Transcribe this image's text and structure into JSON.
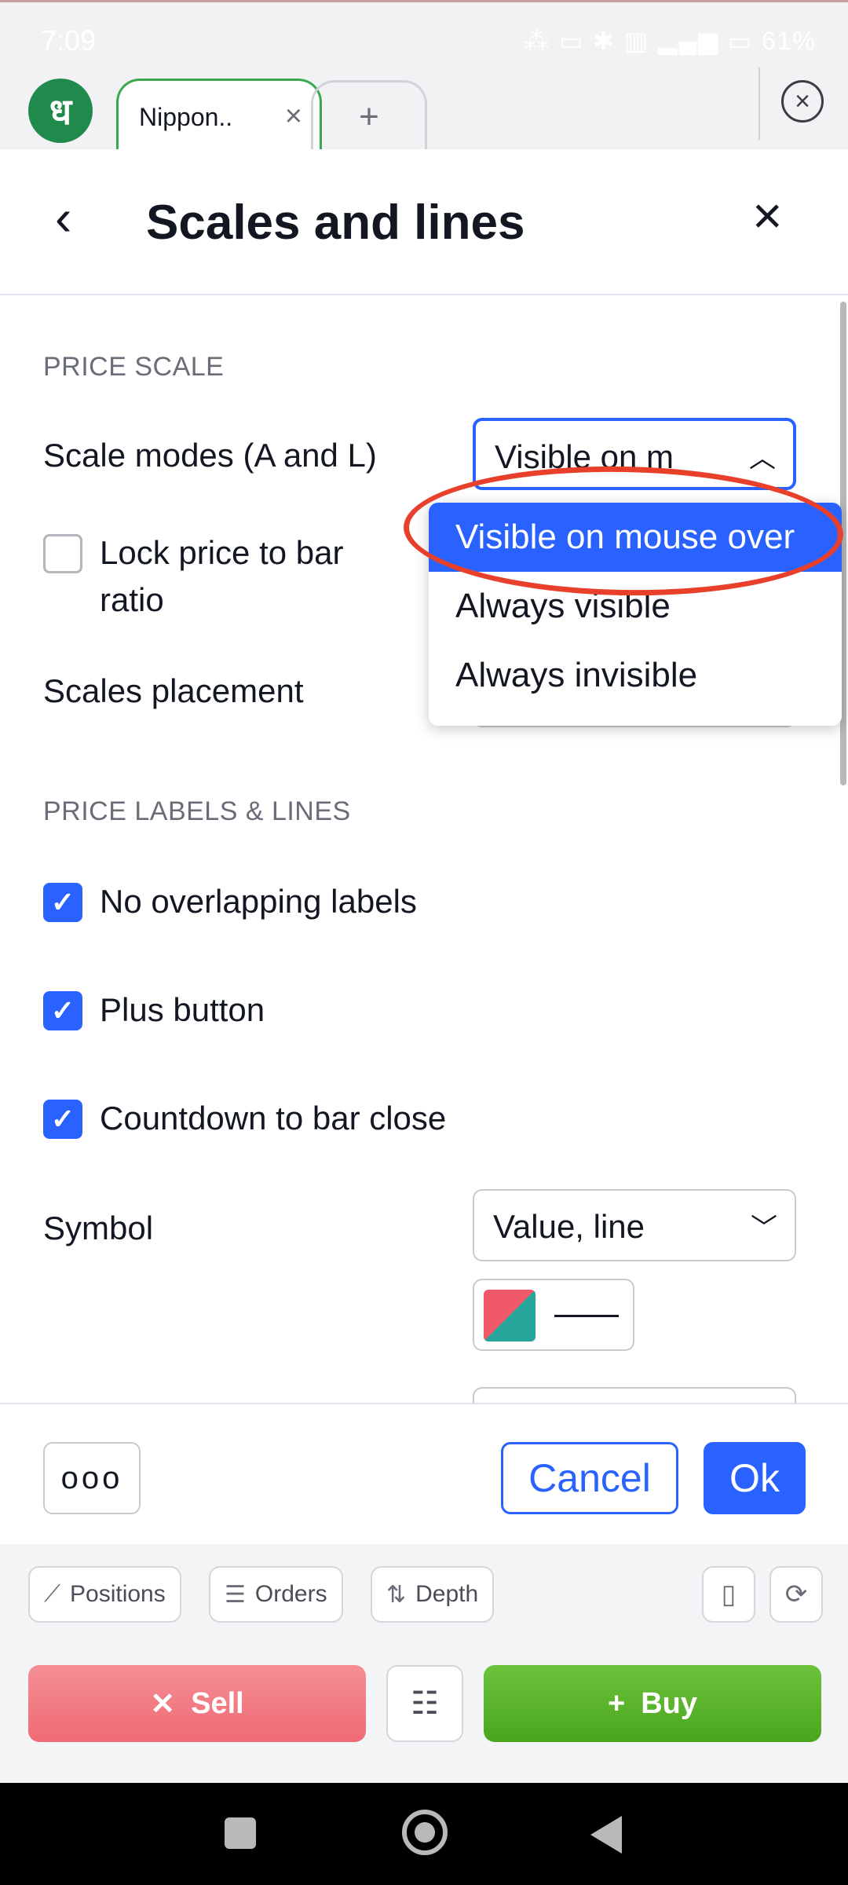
{
  "status_bar": {
    "time": "7:09",
    "icons_text": "⁂ ▭ ✱ ▥ ▂▄▆ ▭ 61%"
  },
  "tabs": {
    "logo_text": "ध",
    "active_label": "Nippon..",
    "close_glyph": "×",
    "new_tab_glyph": "+",
    "bar_close_glyph": "×"
  },
  "header": {
    "back_glyph": "‹",
    "title": "Scales and lines",
    "close_glyph": "×"
  },
  "price_scale": {
    "section_title": "PRICE SCALE",
    "scale_modes_label": "Scale modes (A and L)",
    "scale_modes_value": "Visible on m",
    "lock_price_label_1": "Lock price to bar",
    "lock_price_label_2": "ratio",
    "lock_price_checked": false,
    "scales_placement_label": "Scales placement"
  },
  "dropdown": {
    "options": [
      "Visible on mouse over",
      "Always visible",
      "Always invisible"
    ],
    "selected_index": 0
  },
  "price_labels": {
    "section_title": "PRICE LABELS & LINES",
    "no_overlap_label": "No overlapping labels",
    "plus_button_label": "Plus button",
    "countdown_label": "Countdown to bar close",
    "symbol_label": "Symbol",
    "symbol_value": "Value, line"
  },
  "footer": {
    "more_label": "ooo",
    "cancel_label": "Cancel",
    "ok_label": "Ok"
  },
  "trade_bar": {
    "positions_label": "Positions",
    "orders_label": "Orders",
    "depth_label": "Depth",
    "sell_label": "Sell",
    "buy_label": "Buy"
  },
  "colors": {
    "accent": "#2962ff",
    "sell": "#ef6a74",
    "buy": "#4aa51d",
    "highlight": "#e8402a"
  }
}
